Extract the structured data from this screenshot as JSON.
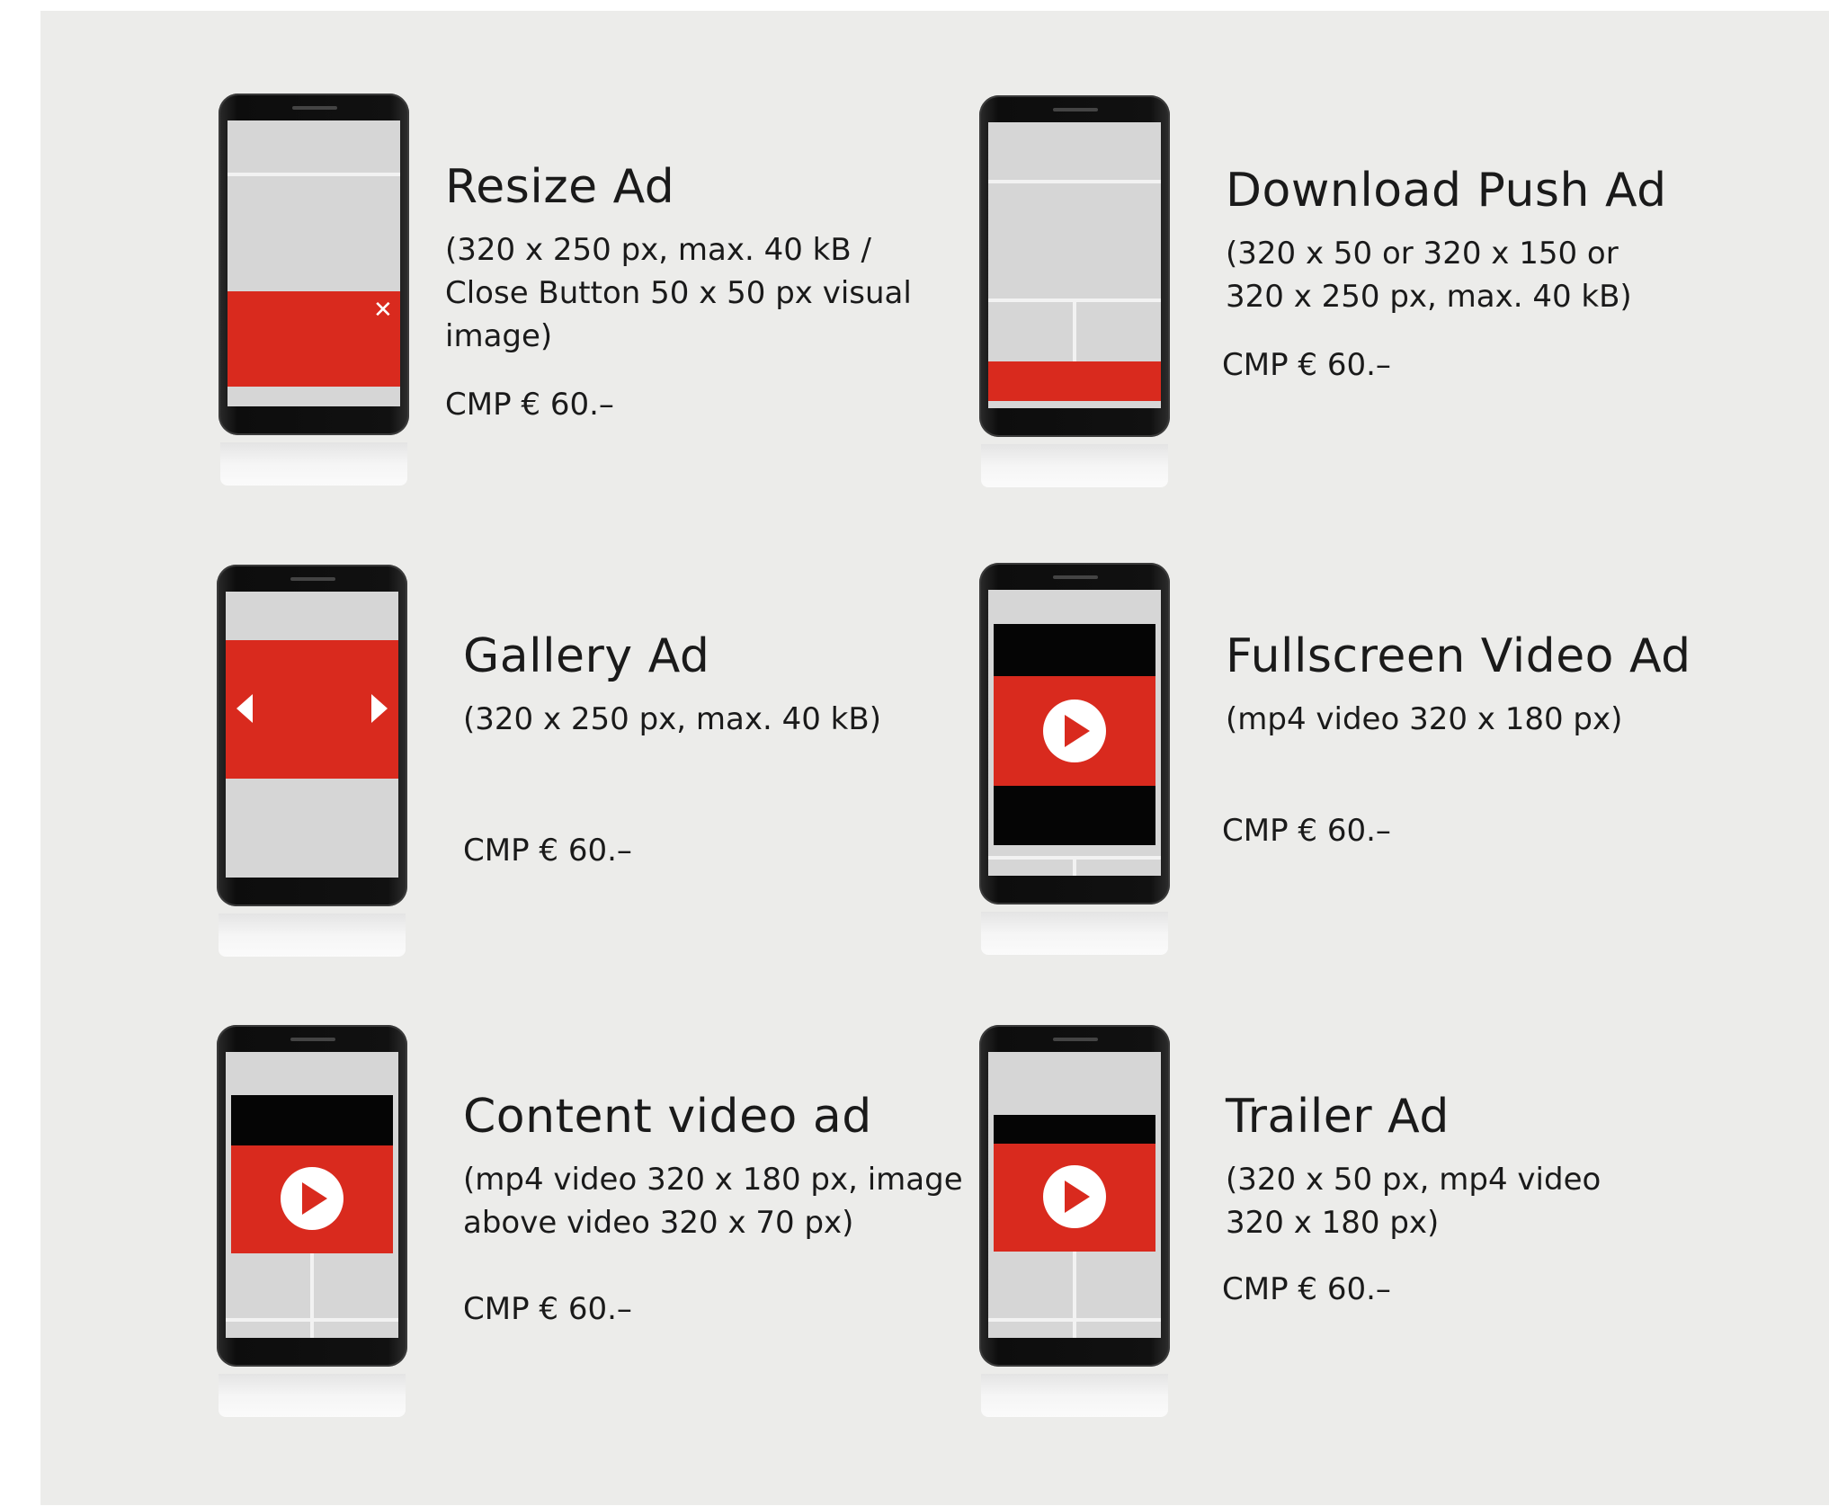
{
  "ads": [
    {
      "title": "Resize Ad",
      "spec_lines": [
        "(320 x 250 px, max. 40 kB /",
        "Close Button 50 x 50 px visual",
        "image)"
      ],
      "price": "CMP € 60.–",
      "illustration": "resize-ad"
    },
    {
      "title": "Download Push Ad",
      "spec_lines": [
        "(320 x 50 or 320 x 150 or",
        "320 x 250 px, max. 40 kB)"
      ],
      "price": "CMP € 60.–",
      "illustration": "download-push-ad"
    },
    {
      "title": "Gallery Ad",
      "spec_lines": [
        "(320 x 250 px, max. 40 kB)"
      ],
      "price": "CMP € 60.–",
      "illustration": "gallery-ad"
    },
    {
      "title": "Fullscreen Video Ad",
      "spec_lines": [
        "(mp4 video 320 x 180 px)"
      ],
      "price": "CMP € 60.–",
      "illustration": "fullscreen-video-ad"
    },
    {
      "title": "Content video ad",
      "spec_lines": [
        "(mp4 video 320 x 180 px, image",
        "above video 320 x 70 px)"
      ],
      "price": "CMP € 60.–",
      "illustration": "content-video-ad"
    },
    {
      "title": "Trailer Ad",
      "spec_lines": [
        "(320 x 50 px, mp4 video",
        "320 x 180 px)"
      ],
      "price": "CMP € 60.–",
      "illustration": "trailer-ad"
    }
  ],
  "colors": {
    "background": "#ececea",
    "ad_red": "#d92a1e",
    "phone_black": "#0d0d0d",
    "screen_gray": "#d6d6d6"
  },
  "icons": {
    "close": "close-icon",
    "play": "play-icon",
    "prev": "arrow-left-icon",
    "next": "arrow-right-icon"
  }
}
